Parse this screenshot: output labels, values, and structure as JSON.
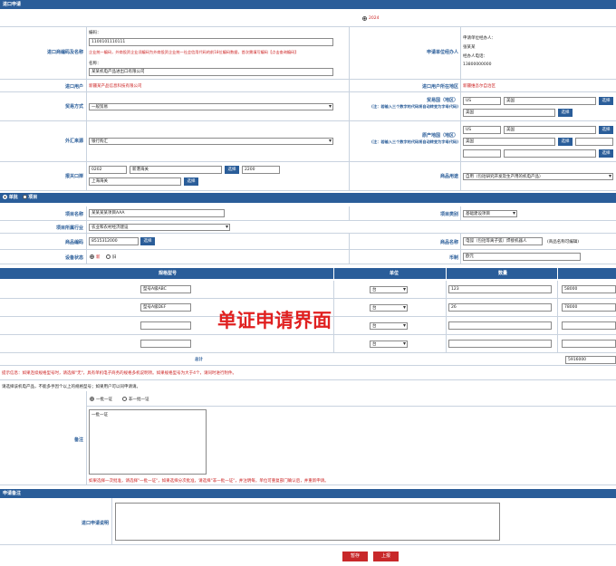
{
  "section1": {
    "title": "进口申请",
    "year_value": "2024"
  },
  "importer": {
    "label": "进口商编码及名称",
    "code_label": "编码：",
    "code_value": "1100101110111",
    "note": "企业统一编码，外商投资企业须编码为外商投资企业统一社会信用代码的前18位编码数据，首次需填写编码【点击查询编码】",
    "name_label": "名称：",
    "name_value": "某某机电产品进出口有限公司"
  },
  "applicant": {
    "label": "申请单位经办人",
    "line1": "申请单位经办人：",
    "line2": "张某某",
    "line3": "经办人电话：",
    "line4": "13800000000"
  },
  "import_user": {
    "label": "进口用户",
    "value": "新疆某产品信息科技有限公司",
    "region_label": "进口用户所在地区",
    "region_value": "新疆维吾尔自治区"
  },
  "trade": {
    "label": "贸易方式",
    "value": "一般贸易",
    "country_label": "贸易国（地区）",
    "country_hint": "(注：若输入三个数字的代码将自动转变为字母代码)",
    "c1_code": "US",
    "c1_name": "美国",
    "c2_name": "美国",
    "select_label": "选择"
  },
  "fx": {
    "label": "外汇来源",
    "value": "银行购汇",
    "origin_label": "原产地国（地区）",
    "origin_hint": "(注：若输入三个数字的代码将自动转变为字母代码)",
    "o1_code": "US",
    "o1_name": "美国",
    "o2_name": "美国"
  },
  "port": {
    "label": "报关口岸",
    "p1_code": "0202",
    "p1_name": "新港海关",
    "p2_code": "2200",
    "p3_name": "上海海关",
    "select_label": "选择",
    "use_label": "商品用途",
    "use_value": "自用（包括研究开发及生产用的机电产品）"
  },
  "mode": {
    "opt1": "单批",
    "opt2": "项目"
  },
  "project": {
    "name_label": "项目名称",
    "name_value": "某某某某项目AAA",
    "cat_label": "项目类别",
    "cat_value": "基础建设项目",
    "industry_label": "项目所属行业",
    "industry_value": "农业和农村经济建设"
  },
  "goods": {
    "code_label": "商品编码",
    "code_value": "8515312000",
    "name_label": "商品名称",
    "name_value": "电弧（包括等离子弧）焊接机器人",
    "name_hint": "(商品名称可编辑)",
    "state_label": "设备状态",
    "state_new": "新",
    "state_old": "旧",
    "curr_label": "币制",
    "curr_value": "欧元"
  },
  "table": {
    "col_model": "规格型号",
    "col_unit": "单位",
    "col_qty": "数量",
    "rows": [
      {
        "model": "型号A级ABC",
        "unit": "台",
        "qty": "123",
        "amt": "58000"
      },
      {
        "model": "型号A级DEF",
        "unit": "台",
        "qty": "26",
        "amt": "78000"
      },
      {
        "model": "",
        "unit": "台",
        "qty": "",
        "amt": ""
      },
      {
        "model": "",
        "unit": "台",
        "qty": "",
        "amt": ""
      }
    ],
    "total_label": "总计",
    "total_value": "5916000",
    "note": "提示信息：如果连续规格型号时，请选择\"无\"，具有单机电子商务的规格多机说明项。如果规格型号为大于4个，请同时进行附件。"
  },
  "overlay_label": "单证申请界面",
  "remarks": {
    "intro": "请选择该机电产品，不能多手因个以上的规格型号；如果用户可以同申请请。",
    "opt1": "一批一证",
    "opt2": "非一批一证",
    "label": "备注",
    "text_value": "一批一证",
    "note": "如果选择一次批准，请选择\"一批一证\"，如果选择分次批准，请选择\"非一批一证\"，并注明每，单位可重复部门确认后，并重新申请。"
  },
  "section2": {
    "title": "申请备注",
    "label": "进口申请说明"
  },
  "actions": {
    "save": "暂存",
    "submit": "上报"
  }
}
